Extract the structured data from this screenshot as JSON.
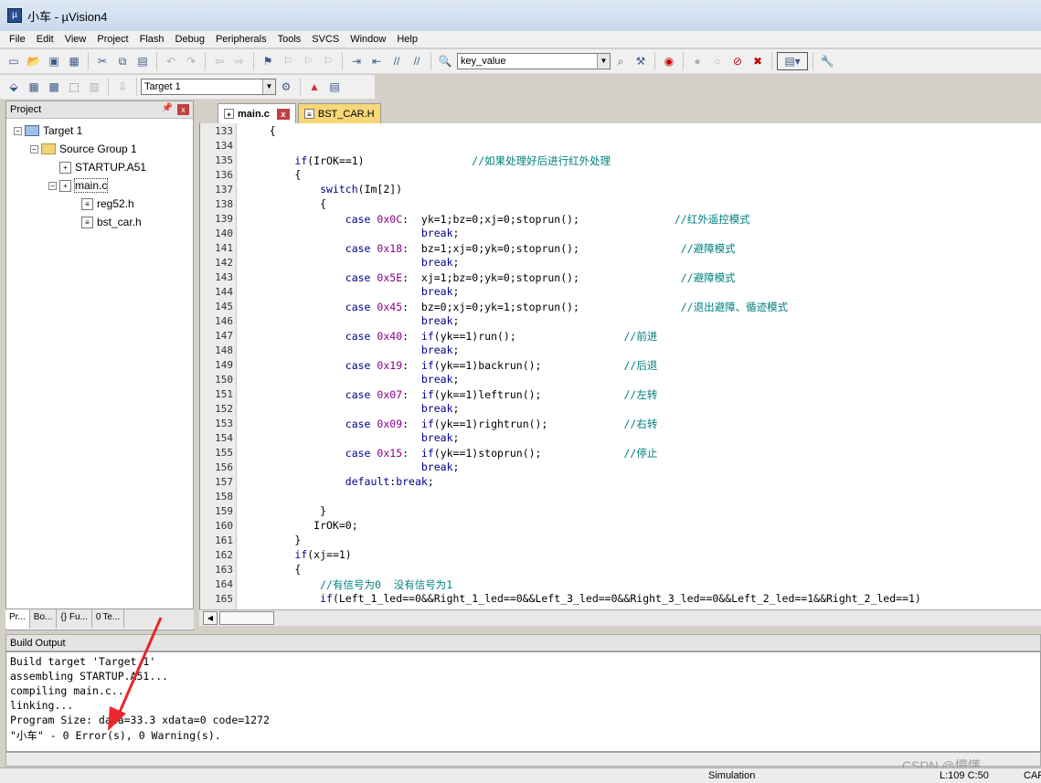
{
  "window": {
    "title": "小车  - µVision4"
  },
  "menu": [
    "File",
    "Edit",
    "View",
    "Project",
    "Flash",
    "Debug",
    "Peripherals",
    "Tools",
    "SVCS",
    "Window",
    "Help"
  ],
  "toolbar": {
    "find_combo": "key_value",
    "target_combo": "Target 1"
  },
  "project": {
    "header": "Project",
    "tree": {
      "target": "Target 1",
      "group": "Source Group 1",
      "startup": "STARTUP.A51",
      "main": "main.c",
      "reg": "reg52.h",
      "bst": "bst_car.h"
    },
    "tabs": [
      "Pr...",
      "Bo...",
      "{} Fu...",
      "0 Te..."
    ]
  },
  "editor": {
    "tabs": {
      "main": "main.c",
      "other": "BST_CAR.H"
    },
    "line_numbers": [
      "133",
      "134",
      "135",
      "136",
      "137",
      "138",
      "139",
      "140",
      "141",
      "142",
      "143",
      "144",
      "145",
      "146",
      "147",
      "148",
      "149",
      "150",
      "151",
      "152",
      "153",
      "154",
      "155",
      "156",
      "157",
      "158",
      "159",
      "160",
      "161",
      "162",
      "163",
      "164",
      "165"
    ],
    "lines": [
      "    {",
      "",
      "        if(IrOK==1)                 //如果处理好后进行红外处理",
      "        {",
      "            switch(Im[2])",
      "            {",
      "                case 0x0C:  yk=1;bz=0;xj=0;stoprun();               //红外遥控模式",
      "                            break;",
      "                case 0x18:  bz=1;xj=0;yk=0;stoprun();                //避障模式",
      "                            break;",
      "                case 0x5E:  xj=1;bz=0;yk=0;stoprun();                //避障模式",
      "                            break;",
      "                case 0x45:  bz=0;xj=0;yk=1;stoprun();                //退出避障、循迹模式",
      "                            break;",
      "                case 0x40:  if(yk==1)run();                 //前进",
      "                            break;",
      "                case 0x19:  if(yk==1)backrun();             //后退",
      "                            break;",
      "                case 0x07:  if(yk==1)leftrun();             //左转",
      "                            break;",
      "                case 0x09:  if(yk==1)rightrun();            //右转",
      "                            break;",
      "                case 0x15:  if(yk==1)stoprun();             //停止",
      "                            break;",
      "                default:break;",
      "",
      "            }",
      "           IrOK=0;",
      "        }",
      "        if(xj==1)",
      "        {",
      "            //有信号为0  没有信号为1",
      "            if(Left_1_led==0&&Right_1_led==0&&Left_3_led==0&&Right_3_led==0&&Left_2_led==1&&Right_2_led==1)"
    ]
  },
  "build": {
    "header": "Build Output",
    "lines": [
      "Build target 'Target 1'",
      "assembling STARTUP.A51...",
      "compiling main.c...",
      "linking...",
      "Program Size: data=33.3 xdata=0 code=1272",
      "\"小车\" - 0 Error(s), 0 Warning(s)."
    ]
  },
  "status": {
    "mode": "Simulation",
    "position": "L:109 C:50",
    "caps": "CAP"
  },
  "watermark": "CSDN @懵懂……",
  "colors": {
    "arrow": "#e8262b",
    "comment": "#008080",
    "keyword": "#00008b",
    "number": "#8b008b"
  }
}
